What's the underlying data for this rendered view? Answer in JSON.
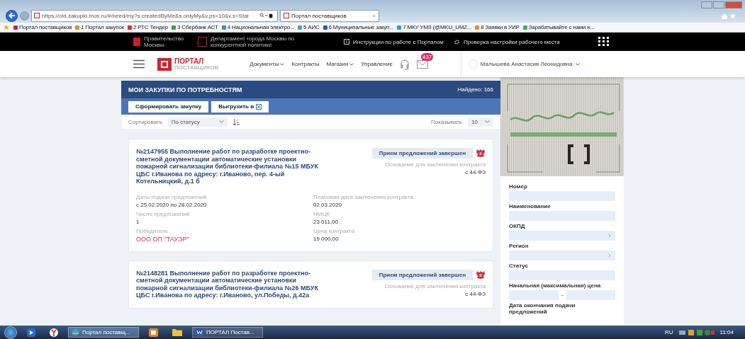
{
  "browser": {
    "url": "https://old.zakupki.mos.ru/#/need/my?s.createdByMe&s.onlyMy&v.ps=10&v.s=Stat",
    "tab": "Портал поставщиков",
    "tab_close": "×"
  },
  "bookmarks": [
    {
      "label": "Портал поставщиков",
      "color": "#d8203a"
    },
    {
      "label": "1 Портал закупок",
      "color": "#c89a2a"
    },
    {
      "label": "2 РТС Тендер",
      "color": "#e0302a"
    },
    {
      "label": "3 Сбербанк АСТ",
      "color": "#3aa040"
    },
    {
      "label": "4 Национальная электро...",
      "color": "#3a8ad0"
    },
    {
      "label": "5 АИС",
      "color": "#5a9ad0"
    },
    {
      "label": "6 Муниципальные закуп...",
      "color": "#3a50c0"
    },
    {
      "label": "7 МКУ УМЗ (@MKU_UMZ...",
      "color": "#2a9ae0"
    },
    {
      "label": "8 Заявки в УИР",
      "color": "#f08a20"
    },
    {
      "label": "Зарабатывайте с нами н...",
      "color": "#40b060"
    }
  ],
  "top_bar": {
    "links": [
      "Правительство Москвы",
      "Департамент города Москвы по конкурентной политике"
    ],
    "tools": [
      "Инструкции по работе с Порталом",
      "Проверка настройки рабочего места"
    ]
  },
  "nav": {
    "logo_top": "ПОРТАЛ",
    "logo_bottom": "ПОСТАВЩИКОВ",
    "items": [
      {
        "label": "Документы",
        "dropdown": true
      },
      {
        "label": "Контракты",
        "dropdown": false
      },
      {
        "label": "Магазин",
        "dropdown": true
      },
      {
        "label": "Управление",
        "dropdown": false
      }
    ],
    "badge": "437",
    "user": "Малышева Анастасия Леонидовна"
  },
  "section": {
    "title": "МОИ ЗАКУПКИ ПО ПОТРЕБНОСТЯМ",
    "found": "Найдено: 166",
    "buttons": [
      "Сформировать закупку",
      "Выгрузить в"
    ]
  },
  "sort": {
    "label": "Сортировать",
    "value": "По статусу",
    "show_label": "Показывать",
    "show_value": "10"
  },
  "purchases": [
    {
      "title": "№2147955 Выполнение работ по разработке проектно-сметной документации автоматические установки пожарной сигнализации библиотеки-филиала №15 МБУК ЦБС г.Иванова по адресу: г.Иваново, пер. 4-ый Котельницкий, д.1 б",
      "status": "Прием предложений завершен",
      "basis_label": "Основание для заключения контракта",
      "basis": "с 44-ФЗ",
      "fields": [
        {
          "label": "Даты подачи предложений",
          "value": "с 25.02.2020 по 28.02.2020",
          "kind": "plain"
        },
        {
          "label": "Плановая дата заключения контракта",
          "value": "02.03.2020",
          "kind": "plain"
        },
        {
          "label": "Число предложений",
          "value": "1",
          "kind": "plain"
        },
        {
          "label": "НМЦК",
          "value": "23 011,00",
          "kind": "plain"
        },
        {
          "label": "Победитель",
          "value": "ООО ОП \"ТАУЭР\"",
          "kind": "winner"
        },
        {
          "label": "Цена контракта",
          "value": "19 000,00",
          "kind": "plain"
        }
      ]
    },
    {
      "title": "№2148281 Выполнение работ по разработке проектно-сметной документации автоматические установки пожарной сигнализации библиотеки-филиала №26 МБУК ЦБС г.Иванова по адресу: г.Иваново, ул.Победы, д.42а",
      "status": "Прием предложений завершен",
      "basis_label": "Основание для заключения контракта",
      "basis": "с 44-ФЗ"
    }
  ],
  "filters": [
    {
      "label": "Номер",
      "kind": "text"
    },
    {
      "label": "Наименование",
      "kind": "text"
    },
    {
      "label": "ОКПД",
      "kind": "select"
    },
    {
      "label": "Регион",
      "kind": "select"
    },
    {
      "label": "Статус",
      "kind": "text"
    },
    {
      "label": "Начальная (максимальная) цена",
      "kind": "range"
    },
    {
      "label": "Дата окончания подачи предложений",
      "kind": "none"
    }
  ],
  "taskbar": {
    "windows": [
      "Портал поставщ...",
      "ПОРТАЛ Постав..."
    ],
    "lang": "RU",
    "time": "11:04"
  }
}
